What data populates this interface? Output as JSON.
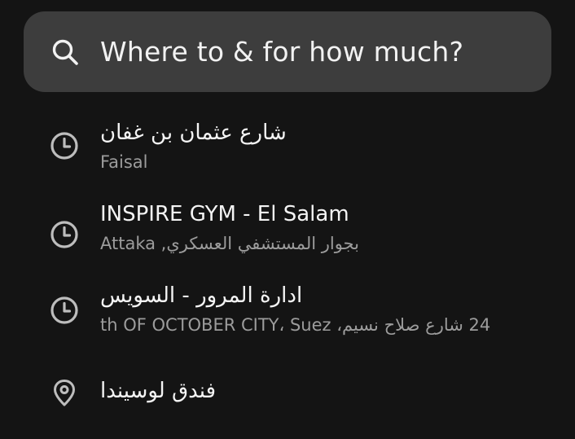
{
  "search": {
    "placeholder": "Where to & for how much?",
    "icon": "search-icon"
  },
  "recent_places": [
    {
      "icon": "clock-icon",
      "title": "شارع عثمان بن غفان",
      "subtitle": "Faisal"
    },
    {
      "icon": "clock-icon",
      "title": "INSPIRE GYM - El Salam",
      "subtitle": "بجوار المستشفي العسكري, Attaka"
    },
    {
      "icon": "clock-icon",
      "title": "ادارة المرور - السويس",
      "subtitle": "24 شارع صلاح نسيم، th OF OCTOBER CITY، Suez"
    },
    {
      "icon": "location-pin-icon",
      "title": "فندق لوسيندا",
      "subtitle": ""
    }
  ],
  "colors": {
    "background": "#141414",
    "search_bar": "#3d3d3d",
    "primary_text": "#f2f2f2",
    "secondary_text": "#9c9c9c",
    "icon": "#bdbdbd"
  }
}
